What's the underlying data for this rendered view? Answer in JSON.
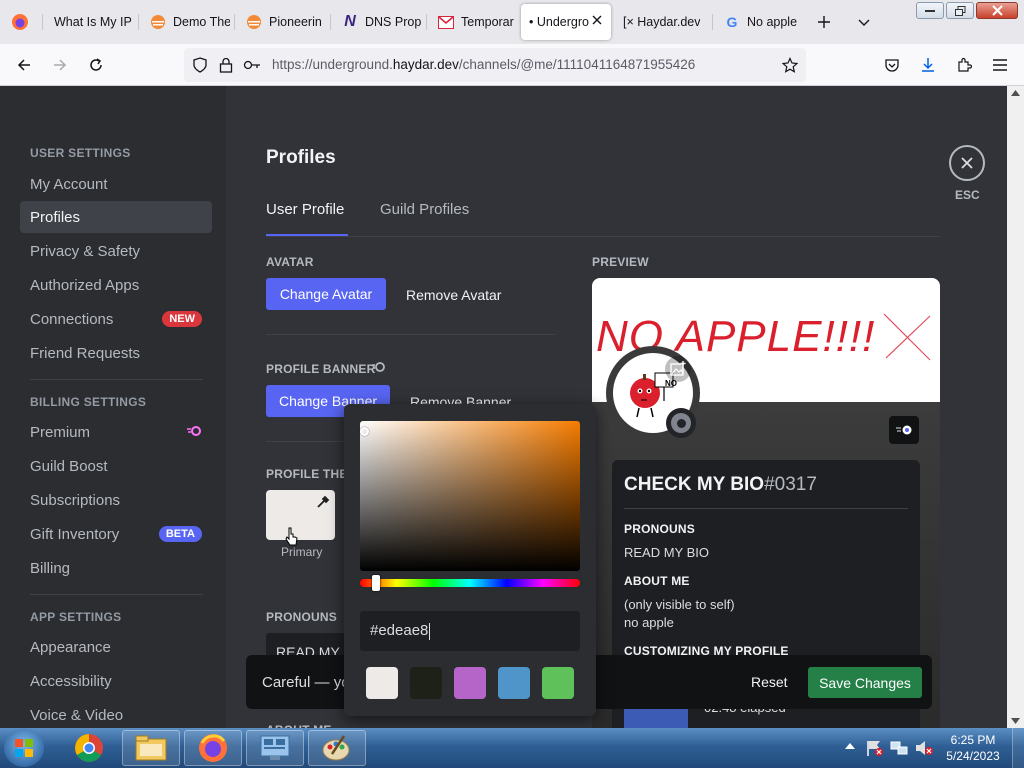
{
  "browser": {
    "tabs": [
      {
        "title": "What Is My IP",
        "icon": "firefox-icon"
      },
      {
        "title": "Demo The",
        "icon": "sunset-icon"
      },
      {
        "title": "Pioneerin",
        "icon": "sunset-icon"
      },
      {
        "title": "DNS Prop",
        "icon": "n-logo-icon"
      },
      {
        "title": "Temporar",
        "icon": "mail-icon"
      },
      {
        "title": "• Undergro",
        "icon": "none"
      },
      {
        "title": "[× Haydar.dev",
        "icon": "none"
      },
      {
        "title": "No apple",
        "icon": "google-icon"
      }
    ],
    "active_tab": 5,
    "url_prefix": "https://underground.",
    "url_domain": "haydar.dev",
    "url_path": "/channels/@me/1111041164871955426"
  },
  "sidebar": {
    "user_settings_label": "USER SETTINGS",
    "user_items": [
      "My Account",
      "Profiles",
      "Privacy & Safety",
      "Authorized Apps",
      "Connections",
      "Friend Requests"
    ],
    "connections_badge": "NEW",
    "billing_label": "BILLING SETTINGS",
    "billing_items": [
      "Premium",
      "Guild Boost",
      "Subscriptions",
      "Gift Inventory",
      "Billing"
    ],
    "gift_badge": "BETA",
    "app_label": "APP SETTINGS",
    "app_items": [
      "Appearance",
      "Accessibility",
      "Voice & Video"
    ]
  },
  "main": {
    "title": "Profiles",
    "tabs": [
      "User Profile",
      "Guild Profiles"
    ],
    "esc_label": "ESC",
    "avatar_label": "AVATAR",
    "change_avatar": "Change Avatar",
    "remove_avatar": "Remove Avatar",
    "banner_label": "PROFILE BANNER",
    "change_banner": "Change Banner",
    "remove_banner": "Remove Banner",
    "theme_label": "PROFILE THE",
    "primary_label": "Primary",
    "pronouns_label": "PRONOUNS",
    "pronouns_value": "READ MY",
    "about_label": "ABOUT ME"
  },
  "preview": {
    "label": "PREVIEW",
    "banner_text": "NO APPLE!!!!",
    "avatar_sign": "NO",
    "username": "CHECK MY BIO",
    "discriminator": "#0317",
    "pronouns_label": "PRONOUNS",
    "pronouns": "READ MY BIO",
    "about_label": "ABOUT ME",
    "about_line1": "(only visible to self)",
    "about_line2": "no apple",
    "customizing_label": "CUSTOMIZING MY PROFILE",
    "elapsed": "02:48 elapsed"
  },
  "toast": {
    "text": "Careful — yo",
    "reset": "Reset",
    "save": "Save Changes"
  },
  "picker": {
    "hex": "#edeae8",
    "hue_base": "#f57c00",
    "swatches": [
      "#edeae8",
      "#1e2117",
      "#b565c8",
      "#4f95c9",
      "#5fc15a"
    ]
  },
  "colors": {
    "brand": "#5865f2",
    "save": "#248046",
    "new_badge": "#da373c",
    "beta_badge": "#5865f2",
    "banner_text": "#d9202c"
  },
  "taskbar": {
    "time": "6:25 PM",
    "date": "5/24/2023"
  }
}
